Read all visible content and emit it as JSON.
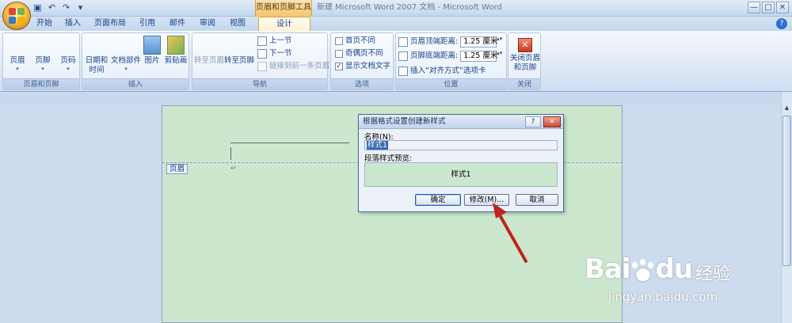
{
  "window": {
    "context_title": "页眉和页脚工具",
    "app_title": "新建 Microsoft Word 2007 文档 - Microsoft Word",
    "controls": [
      "—",
      "□",
      "✕"
    ]
  },
  "tabs": [
    {
      "label": "开始"
    },
    {
      "label": "插入"
    },
    {
      "label": "页面布局"
    },
    {
      "label": "引用"
    },
    {
      "label": "邮件"
    },
    {
      "label": "审阅"
    },
    {
      "label": "视图"
    },
    {
      "label": "设计",
      "active": true
    }
  ],
  "ribbon": {
    "groups": {
      "header_footer": {
        "label": "页眉和页脚",
        "buttons": [
          {
            "label": "页眉"
          },
          {
            "label": "页脚"
          },
          {
            "label": "页码"
          }
        ]
      },
      "insert": {
        "label": "插入",
        "buttons": [
          {
            "label": "日期和",
            "label2": "时间"
          },
          {
            "label": "文档部件"
          },
          {
            "label": "图片"
          },
          {
            "label": "剪贴画"
          }
        ]
      },
      "navigation": {
        "label": "导航",
        "goto_header": "转至页眉",
        "goto_footer": "转至页脚",
        "prev_section": "上一节",
        "next_section": "下一节",
        "link_previous": "链接到前一条页眉"
      },
      "options": {
        "label": "选项",
        "first_page_different": "首页不同",
        "odd_even_different": "奇偶页不同",
        "show_doc_text": "显示文档文字",
        "show_doc_text_checked": true
      },
      "position": {
        "label": "位置",
        "header_from_top_label": "页眉顶端距离:",
        "header_from_top_value": "1.25 厘米",
        "footer_from_bottom_label": "页脚底端距离:",
        "footer_from_bottom_value": "1.25 厘米",
        "insert_align_tab": "插入“对齐方式”选项卡"
      },
      "close": {
        "label": "关闭",
        "button_line1": "关闭页眉",
        "button_line2": "和页脚"
      }
    }
  },
  "document": {
    "header_tag": "页眉",
    "para_mark": "↵"
  },
  "dialog": {
    "title": "根据格式设置创建新样式",
    "help_btn": "?",
    "close_btn": "✕",
    "name_label": "名称(N):",
    "name_value": "样式1",
    "preview_label": "段落样式预览:",
    "preview_text": "样式1",
    "ok": "确定",
    "modify": "修改(M)...",
    "cancel": "取消"
  },
  "watermark": {
    "brand": "Bai",
    "brand2": "du",
    "brand_cn": "经验",
    "url": "jingyan.baidu.com"
  },
  "colors": {
    "annotation_arrow": "#c0241c",
    "page_background": "#cbe8cf",
    "ribbon_text": "#15428b"
  }
}
